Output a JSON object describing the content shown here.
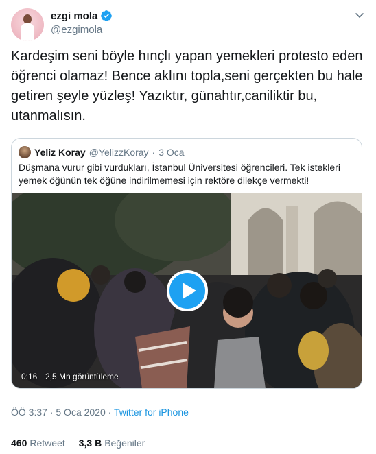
{
  "author": {
    "display_name": "ezgi mola",
    "handle": "@ezgimola",
    "verified_icon": "verified-badge-icon",
    "menu_icon": "chevron-down-icon"
  },
  "tweet": {
    "text": "Kardeşim seni böyle hınçlı yapan yemekleri protesto eden öğrenci olamaz! Bence aklını topla,seni gerçekten bu hale getiren şeyle yüzleş! Yazıktır, günahtır,caniliktir bu, utanmalısın."
  },
  "quoted_tweet": {
    "display_name": "Yeliz Koray",
    "handle": "@YelizzKoray",
    "separator": "·",
    "date": "3 Oca",
    "text": "Düşmana vurur gibi vurdukları, İstanbul Üniversitesi öğrencileri. Tek istekleri yemek öğünün tek öğüne indirilmemesi için rektöre dilekçe vermekti!",
    "video": {
      "duration": "0:16",
      "views": "2,5 Mn görüntüleme",
      "play_icon": "play-icon"
    }
  },
  "meta": {
    "time": "ÖÖ 3:37",
    "separator1": " · ",
    "date": "5 Oca 2020",
    "separator2": " · ",
    "source": "Twitter for iPhone"
  },
  "stats": {
    "retweets_count": "460",
    "retweets_label": "Retweet",
    "likes_count": "3,3 B",
    "likes_label": "Beğeniler"
  },
  "colors": {
    "accent": "#1da1f2",
    "link": "#1b95e0",
    "secondary_text": "#657786",
    "border": "#ccd6dd"
  }
}
